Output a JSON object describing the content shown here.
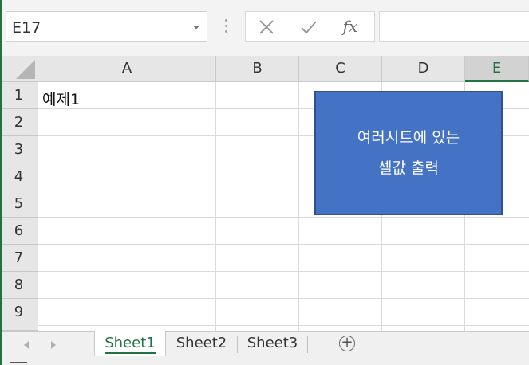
{
  "name_box": {
    "value": "E17"
  },
  "formula_bar": {
    "fx_label": "fx",
    "value": ""
  },
  "columns": [
    {
      "label": "A",
      "selected": false
    },
    {
      "label": "B",
      "selected": false
    },
    {
      "label": "C",
      "selected": false
    },
    {
      "label": "D",
      "selected": false
    },
    {
      "label": "E",
      "selected": true
    }
  ],
  "rows": [
    "1",
    "2",
    "3",
    "4",
    "5",
    "6",
    "7",
    "8",
    "9"
  ],
  "cells": {
    "A1": "예제1"
  },
  "shape": {
    "line1": "여러시트에 있는",
    "line2": "셀값 출력",
    "fill": "#4472c4"
  },
  "sheet_tabs": [
    {
      "label": "Sheet1",
      "active": true
    },
    {
      "label": "Sheet2",
      "active": false
    },
    {
      "label": "Sheet3",
      "active": false
    }
  ],
  "colors": {
    "accent": "#217346",
    "shape_fill": "#4472c4"
  },
  "icons": [
    "cancel-x-icon",
    "enter-check-icon",
    "fx-icon",
    "add-sheet-icon",
    "dropdown-arrow-icon"
  ]
}
